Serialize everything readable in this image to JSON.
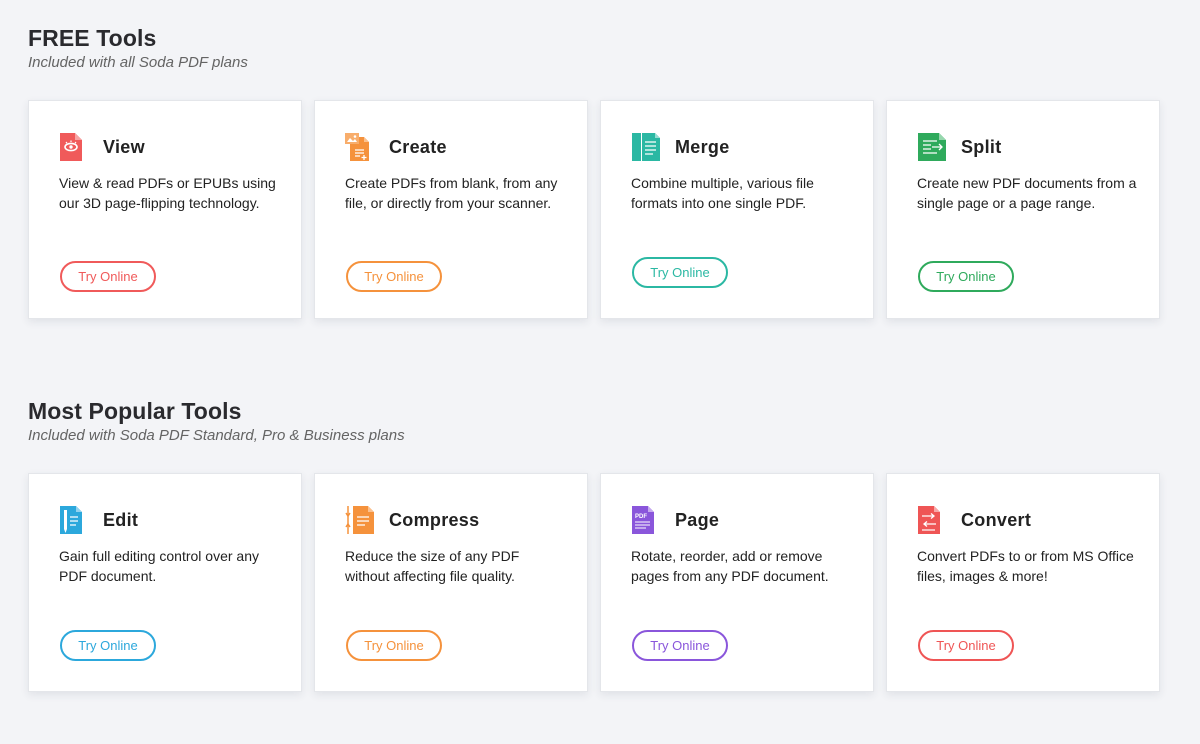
{
  "free": {
    "title": "FREE Tools",
    "subtitle": "Included with all Soda PDF plans",
    "cards": [
      {
        "title": "View",
        "desc": "View & read PDFs or EPUBs using our 3D page-flipping technology.",
        "button": "Try Online",
        "color": "#f05a5a",
        "icon": "view-icon"
      },
      {
        "title": "Create",
        "desc": "Create PDFs from blank, from any file, or directly from your scanner.",
        "button": "Try Online",
        "color": "#f5923c",
        "icon": "create-icon"
      },
      {
        "title": "Merge",
        "desc": "Combine multiple, various file formats into one single PDF.",
        "button": "Try Online",
        "color": "#2bb8a3",
        "icon": "merge-icon"
      },
      {
        "title": "Split",
        "desc": "Create new PDF documents from a single page or a page range.",
        "button": "Try Online",
        "color": "#2faa5c",
        "icon": "split-icon"
      }
    ]
  },
  "popular": {
    "title": "Most Popular Tools",
    "subtitle": "Included with Soda PDF Standard, Pro & Business plans",
    "cards": [
      {
        "title": "Edit",
        "desc": "Gain full editing control over any PDF document.",
        "button": "Try Online",
        "color": "#2ca8dc",
        "icon": "edit-icon"
      },
      {
        "title": "Compress",
        "desc": "Reduce the size of any PDF without affecting file quality.",
        "button": "Try Online",
        "color": "#f5923c",
        "icon": "compress-icon"
      },
      {
        "title": "Page",
        "desc": "Rotate, reorder, add or remove pages from any PDF document.",
        "button": "Try Online",
        "color": "#8a56db",
        "icon": "page-icon",
        "icon_text": "PDF"
      },
      {
        "title": "Convert",
        "desc": "Convert PDFs to or from MS Office files, images & more!",
        "button": "Try Online",
        "color": "#ef5555",
        "icon": "convert-icon"
      }
    ]
  }
}
